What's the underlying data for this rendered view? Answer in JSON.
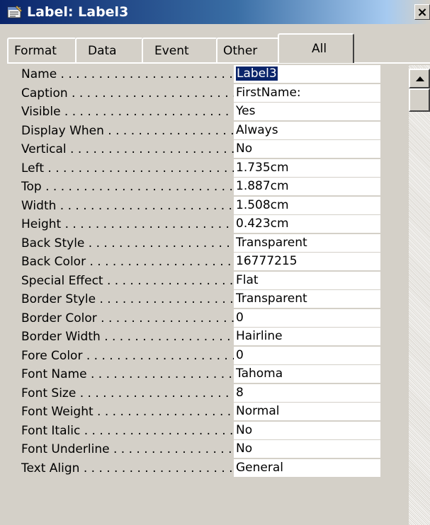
{
  "window": {
    "title": "Label: Label3",
    "icon": "properties-icon",
    "close_label": "×"
  },
  "tabs": [
    {
      "label": "Format"
    },
    {
      "label": "Data"
    },
    {
      "label": "Event"
    },
    {
      "label": "Other"
    },
    {
      "label": "All",
      "active": true
    }
  ],
  "properties": [
    {
      "name": "Name",
      "value": "Label3",
      "selected": true
    },
    {
      "name": "Caption",
      "value": "FirstName:"
    },
    {
      "name": "Visible",
      "value": "Yes"
    },
    {
      "name": "Display When",
      "value": "Always"
    },
    {
      "name": "Vertical",
      "value": "No"
    },
    {
      "name": "Left",
      "value": "1.735cm"
    },
    {
      "name": "Top",
      "value": "1.887cm"
    },
    {
      "name": "Width",
      "value": "1.508cm"
    },
    {
      "name": "Height",
      "value": "0.423cm"
    },
    {
      "name": "Back Style",
      "value": "Transparent"
    },
    {
      "name": "Back Color",
      "value": "16777215"
    },
    {
      "name": "Special Effect",
      "value": "Flat"
    },
    {
      "name": "Border Style",
      "value": "Transparent"
    },
    {
      "name": "Border Color",
      "value": "0"
    },
    {
      "name": "Border Width",
      "value": "Hairline"
    },
    {
      "name": "Fore Color",
      "value": "0"
    },
    {
      "name": "Font Name",
      "value": "Tahoma"
    },
    {
      "name": "Font Size",
      "value": "8"
    },
    {
      "name": "Font Weight",
      "value": "Normal"
    },
    {
      "name": "Font Italic",
      "value": "No"
    },
    {
      "name": "Font Underline",
      "value": "No"
    },
    {
      "name": "Text Align",
      "value": "General"
    }
  ],
  "scrollbar": {
    "up_icon": "arrow-up-icon"
  }
}
